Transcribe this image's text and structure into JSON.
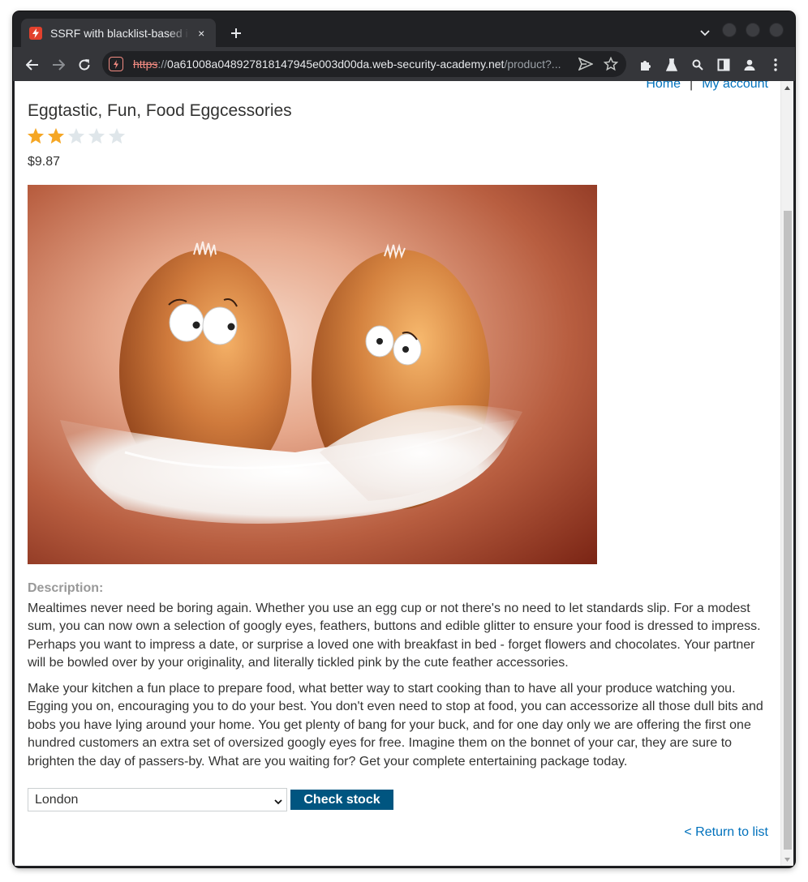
{
  "browser": {
    "tab_title": "SSRF with blacklist-based input filter",
    "tab_close": "×",
    "new_tab": "+",
    "url_scheme": "https",
    "url_sep": "://",
    "url_host": "0a61008a048927818147945e003d00da.web-security-academy.net",
    "url_path": "/product?..."
  },
  "nav": {
    "home_label": "Home",
    "separator": "|",
    "account_label": "My account"
  },
  "product": {
    "title": "Eggtastic, Fun, Food Eggcessories",
    "rating": 2,
    "rating_max": 5,
    "price": "$9.87",
    "description_label": "Description:",
    "description_p1": "Mealtimes never need be boring again. Whether you use an egg cup or not there's no need to let standards slip. For a modest sum, you can now own a selection of googly eyes, feathers, buttons and edible glitter to ensure your food is dressed to impress. Perhaps you want to impress a date, or surprise a loved one with breakfast in bed - forget flowers and chocolates. Your partner will be bowled over by your originality, and literally tickled pink by the cute feather accessories.",
    "description_p2": "Make your kitchen a fun place to prepare food, what better way to start cooking than to have all your produce watching you. Egging you on, encouraging you to do your best. You don't even need to stop at food, you can accessorize all those dull bits and bobs you have lying around your home. You get plenty of bang for your buck, and for one day only we are offering the first one hundred customers an extra set of oversized googly eyes for free. Imagine them on the bonnet of your car, they are sure to brighten the day of passers-by. What are you waiting for? Get your complete entertaining package today."
  },
  "stock": {
    "selected_store": "London",
    "check_label": "Check stock"
  },
  "footer": {
    "return_label": "< Return to list"
  },
  "colors": {
    "link": "#0071bc",
    "button": "#005580",
    "star_filled": "#f5a623",
    "star_empty": "#dfe6ea",
    "chrome_dark": "#202124",
    "chrome_toolbar": "#35363a"
  }
}
